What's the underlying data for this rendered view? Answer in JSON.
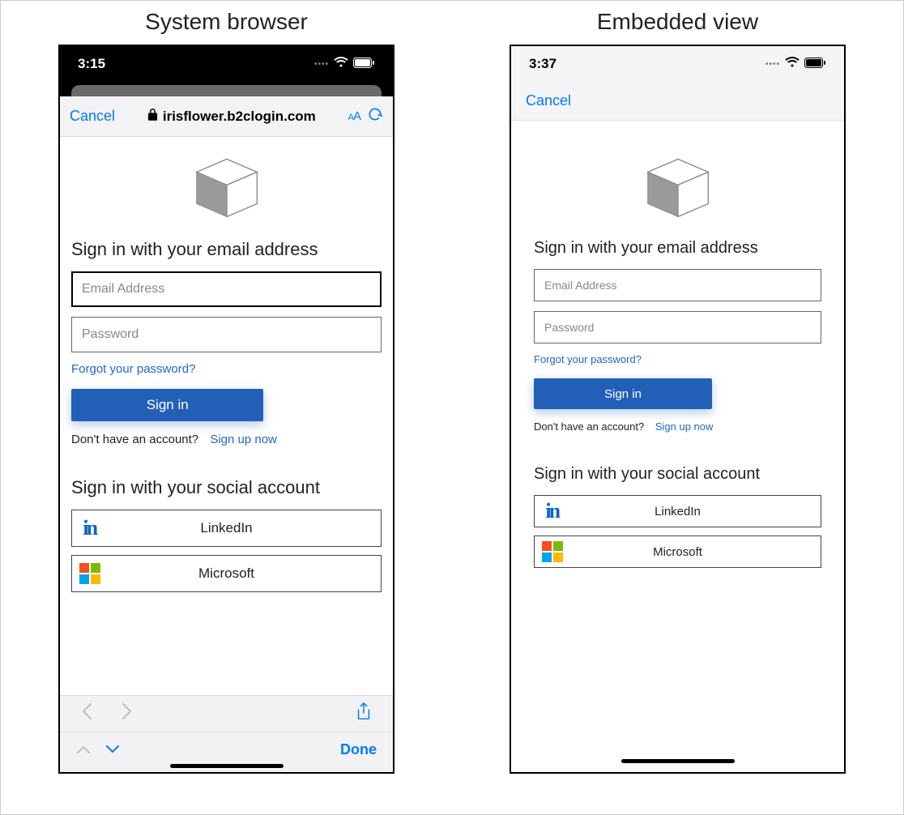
{
  "columns": {
    "left_title": "System browser",
    "right_title": "Embedded view"
  },
  "status": {
    "time_left": "3:15",
    "time_right": "3:37"
  },
  "browser": {
    "cancel": "Cancel",
    "domain": "irisflower.b2clogin.com",
    "text_size_label": "AA",
    "done": "Done"
  },
  "signin": {
    "heading": "Sign in with your email address",
    "email_placeholder": "Email Address",
    "password_placeholder": "Password",
    "forgot": "Forgot your password?",
    "button": "Sign in",
    "no_account": "Don't have an account?",
    "signup": "Sign up now",
    "social_heading": "Sign in with your social account",
    "linkedin": "LinkedIn",
    "microsoft": "Microsoft"
  }
}
